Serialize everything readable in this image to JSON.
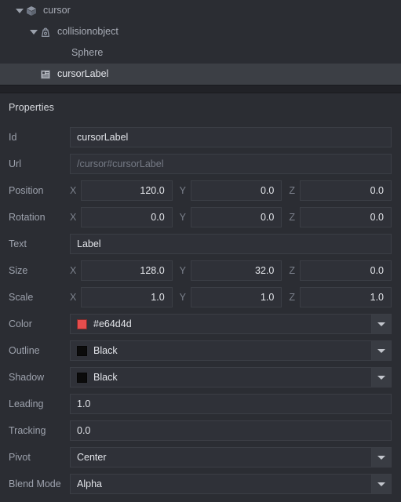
{
  "outliner": {
    "name": "scene-outliner",
    "nodes": [
      {
        "label": "cursor",
        "icon": "cube-icon",
        "depth": 0,
        "expanded": true,
        "has_twisty": true,
        "selected": false
      },
      {
        "label": "collisionobject",
        "icon": "physics-icon",
        "depth": 1,
        "expanded": true,
        "has_twisty": true,
        "selected": false
      },
      {
        "label": "Sphere",
        "icon": "sphere-icon",
        "depth": 2,
        "expanded": false,
        "has_twisty": false,
        "selected": false
      },
      {
        "label": "cursorLabel",
        "icon": "label-icon",
        "depth": 1,
        "expanded": false,
        "has_twisty": false,
        "selected": true
      }
    ]
  },
  "properties": {
    "title": "Properties",
    "rows": [
      {
        "label": "Id",
        "type": "text",
        "value": "cursorLabel",
        "placeholder": ""
      },
      {
        "label": "Url",
        "type": "text",
        "value": "",
        "placeholder": "/cursor#cursorLabel"
      },
      {
        "label": "Position",
        "type": "vector",
        "x": "120.0",
        "y": "0.0",
        "z": "0.0"
      },
      {
        "label": "Rotation",
        "type": "vector",
        "x": "0.0",
        "y": "0.0",
        "z": "0.0"
      },
      {
        "label": "Text",
        "type": "text",
        "value": "Label",
        "placeholder": ""
      },
      {
        "label": "Size",
        "type": "vector",
        "x": "128.0",
        "y": "32.0",
        "z": "0.0"
      },
      {
        "label": "Scale",
        "type": "vector",
        "x": "1.0",
        "y": "1.0",
        "z": "1.0"
      },
      {
        "label": "Color",
        "type": "color",
        "value": "#e64d4d",
        "swatch": "#e64d4d"
      },
      {
        "label": "Outline",
        "type": "color",
        "value": "Black",
        "swatch": "#0b0b0b"
      },
      {
        "label": "Shadow",
        "type": "color",
        "value": "Black",
        "swatch": "#0b0b0b"
      },
      {
        "label": "Leading",
        "type": "text",
        "value": "1.0",
        "placeholder": ""
      },
      {
        "label": "Tracking",
        "type": "text",
        "value": "0.0",
        "placeholder": ""
      },
      {
        "label": "Pivot",
        "type": "select",
        "value": "Center"
      },
      {
        "label": "Blend Mode",
        "type": "select",
        "value": "Alpha"
      }
    ],
    "axis_labels": {
      "x": "X",
      "y": "Y",
      "z": "Z"
    }
  }
}
